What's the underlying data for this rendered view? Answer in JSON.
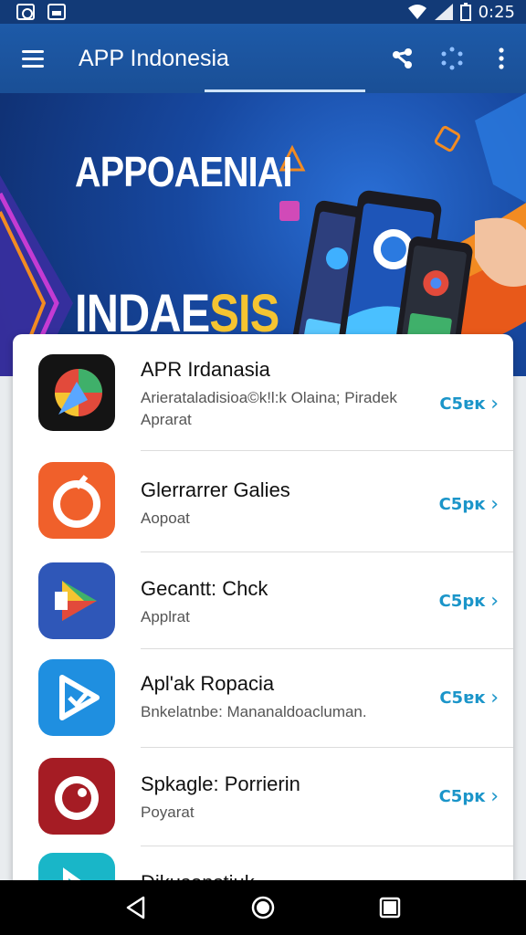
{
  "status_bar": {
    "time": "0:25"
  },
  "app_bar": {
    "title": "APP Indonesia"
  },
  "banner": {
    "line1": "APPOAENIAI",
    "line2_a": "INDAE",
    "line2_b": "SIS",
    "accent_color": "#f5c431"
  },
  "list": {
    "items": [
      {
        "name": "APR Irdanasia",
        "sub1": "Arierataladisioa©k!l:k Olaina; Piradek",
        "sub2": "Aprarat",
        "action": "C5ɐĸ",
        "icon": "compass-icon"
      },
      {
        "name": "Glerrarrer Galies",
        "sub1": "Aopoat",
        "action": "C5pĸ",
        "icon": "fruit-icon"
      },
      {
        "name": "Gecantt: Chck",
        "sub1": "Applrat",
        "action": "C5pĸ",
        "icon": "play-store-icon"
      },
      {
        "name": "Apl'ak Ropacia",
        "sub1": "Bnkelatnbe: Mananaldoacluman.",
        "action": "C5ɐĸ",
        "icon": "play-check-icon"
      },
      {
        "name": "Spkagle: Porrierin",
        "sub1": "Poyarat",
        "action": "C5pĸ",
        "icon": "ring-icon"
      },
      {
        "name": "Dikusonstiuk",
        "sub1": "",
        "action": "",
        "icon": "teal-play-icon"
      }
    ]
  },
  "colors": {
    "primary": "#1d5aa8",
    "status": "#123a77",
    "action": "#1b95c9"
  }
}
